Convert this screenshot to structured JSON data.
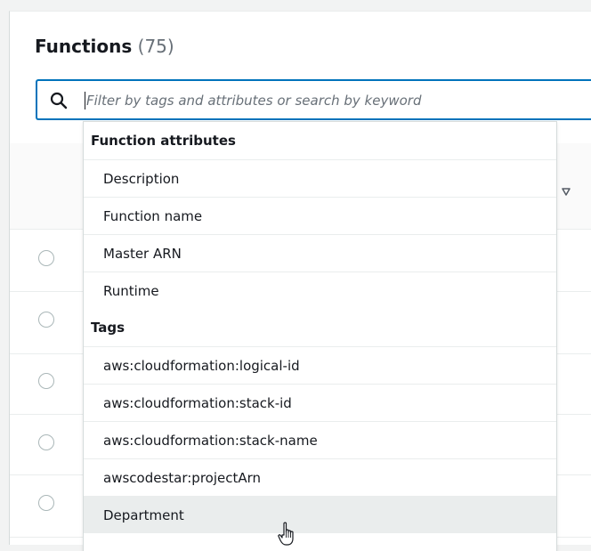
{
  "panel": {
    "title": "Functions",
    "count": "(75)"
  },
  "search": {
    "placeholder": "Filter by tags and attributes or search by keyword",
    "value": ""
  },
  "dropdown": {
    "groups": [
      {
        "label": "Function attributes",
        "options": [
          "Description",
          "Function name",
          "Master ARN",
          "Runtime"
        ]
      },
      {
        "label": "Tags",
        "options": [
          "aws:cloudformation:logical-id",
          "aws:cloudformation:stack-id",
          "aws:cloudformation:stack-name",
          "awscodestar:projectArn",
          "Department"
        ]
      }
    ],
    "highlighted": "Department"
  },
  "colors": {
    "accent": "#0073bb",
    "highlight": "#eaeded",
    "text": "#16191f"
  }
}
